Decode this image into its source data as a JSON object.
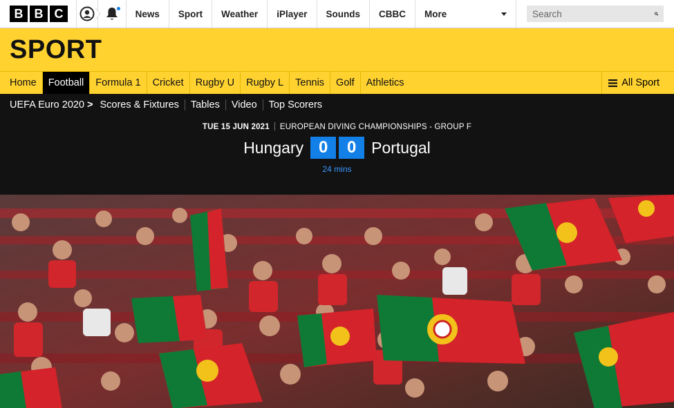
{
  "header": {
    "logo_letters": [
      "B",
      "B",
      "C"
    ],
    "nav": [
      "News",
      "Sport",
      "Weather",
      "iPlayer",
      "Sounds",
      "CBBC"
    ],
    "more_label": "More",
    "search_placeholder": "Search"
  },
  "sport": {
    "title": "SPORT",
    "nav": [
      "Home",
      "Football",
      "Formula 1",
      "Cricket",
      "Rugby U",
      "Rugby L",
      "Tennis",
      "Golf",
      "Athletics"
    ],
    "active": "Football",
    "all_sport_label": "All Sport"
  },
  "subnav": {
    "section": "UEFA Euro 2020",
    "items": [
      "Scores & Fixtures",
      "Tables",
      "Video",
      "Top Scorers"
    ]
  },
  "match": {
    "date": "TUE 15 JUN 2021",
    "competition": "EUROPEAN DIVING CHAMPIONSHIPS - GROUP F",
    "home_team": "Hungary",
    "away_team": "Portugal",
    "home_score": "0",
    "away_score": "0",
    "time": "24 mins"
  },
  "colors": {
    "accent": "#ffd230",
    "score_box": "#1380e8",
    "dark_bg": "#121212"
  },
  "photo": {
    "description_icon": "stadium-crowd-image"
  }
}
